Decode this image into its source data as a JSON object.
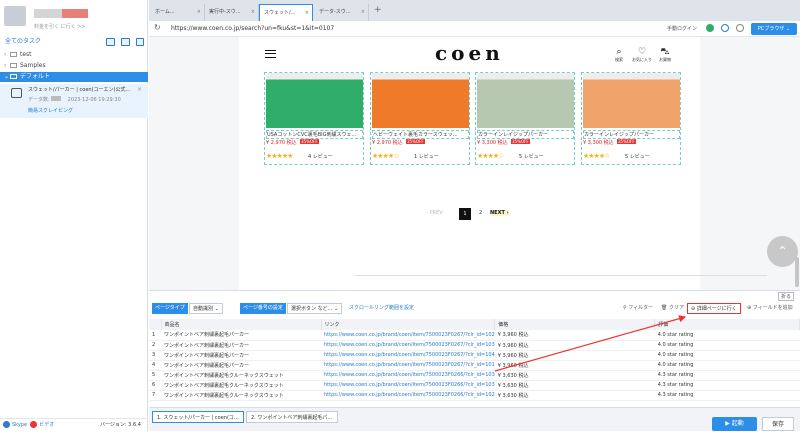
{
  "user": {
    "subtitle": "料金を引く に行く >>"
  },
  "sidebar": {
    "all_tasks": "全てのタスク",
    "folders": [
      {
        "name": "test"
      },
      {
        "name": "Samples"
      }
    ],
    "default_group": "デフォルト",
    "task": {
      "title": "スウェット/パーカー | coen(コーエン)公式...",
      "data_label": "データ数:",
      "date": "2023-12-06 19:29:30",
      "link": "簡易スクレイピング"
    },
    "footer": {
      "skype": "Skype",
      "video": "ビデオ",
      "version": "バージョン: 3.6.4"
    }
  },
  "browser": {
    "tabs": [
      {
        "label": "ホーム..."
      },
      {
        "label": "実行中-スウ..."
      },
      {
        "label": "スウェット/..."
      },
      {
        "label": "データ-スウ..."
      }
    ],
    "plus": "+",
    "url": "https://www.coen.co.jp/search?un=fku&st=1&it=0107",
    "login": "手動ログイン",
    "mode_button": "PCブラウザ ⌄"
  },
  "page": {
    "logo": "coen",
    "header_icons": [
      {
        "name": "search",
        "glyph": "⌕",
        "label": "検索"
      },
      {
        "name": "heart",
        "glyph": "♡",
        "label": "お気に入り"
      },
      {
        "name": "cart",
        "glyph": "⛍",
        "label": "お買物"
      }
    ],
    "products": [
      {
        "title": "USAコットンCVC裏毛BIG刺繍スウェ...",
        "price": "¥ 2,970 税込",
        "off": "35%OFF",
        "stars": "★★★★★",
        "reviews": "4 レビュー",
        "color": "#2fae6a"
      },
      {
        "title": "ヘビーウェイト裏毛カラースウェッ...",
        "price": "¥ 2,970 税込",
        "off": "35%OFF",
        "stars": "★★★★☆",
        "reviews": "1 レビュー",
        "color": "#ef7a2a"
      },
      {
        "title": "カラーインレイジップパーカー",
        "price": "¥ 3,300 税込",
        "off": "35%OFF",
        "stars": "★★★★☆",
        "reviews": "5 レビュー",
        "color": "#b7c8b0"
      },
      {
        "title": "カラーインレイジップパーカー",
        "price": "¥ 3,300 税込",
        "off": "35%OFF",
        "stars": "★★★★☆",
        "reviews": "5 レビュー",
        "color": "#f0a36a"
      }
    ],
    "pager": {
      "prev": "‹ PREV",
      "current": "1",
      "next_page": "2",
      "next": "NEXT ›"
    },
    "to_top": "⌃"
  },
  "panel": {
    "collapse": "折る",
    "page_type_tag": "ページタイプ",
    "page_type_value": "自動識別 ⌄",
    "page_num_tag": "ページ番号の設定",
    "page_num_value": "選択ボタン など... ⌄",
    "scroll_link": "スクロールリング範囲を設定",
    "filter": "フィルター",
    "clear": "クリア",
    "detail": "詳細ページに行く",
    "add_field": "フィールドを追加",
    "columns": [
      "",
      "商品名",
      "リンク",
      "価格",
      "評価"
    ],
    "rows": [
      [
        "1",
        "ワンポイントベア刺繍裏起毛パーカー",
        "https://www.coen.co.jp/brand/coen/item/7500023F0267/?clr_id=102",
        "¥ 3,960 税込",
        "4.0 star rating"
      ],
      [
        "2",
        "ワンポイントベア刺繍裏起毛パーカー",
        "https://www.coen.co.jp/brand/coen/item/7500023F0267/?clr_id=103",
        "¥ 3,960 税込",
        "4.0 star rating"
      ],
      [
        "3",
        "ワンポイントベア刺繍裏起毛パーカー",
        "https://www.coen.co.jp/brand/coen/item/7500023F0267/?clr_id=104",
        "¥ 3,960 税込",
        "4.0 star rating"
      ],
      [
        "4",
        "ワンポイントベア刺繍裏起毛パーカー",
        "https://www.coen.co.jp/brand/coen/item/7500023F0267/?clr_id=101",
        "¥ 3,960 税込",
        "4.0 star rating"
      ],
      [
        "5",
        "ワンポイントベア刺繍裏起毛クルーネックスウェット",
        "https://www.coen.co.jp/brand/coen/item/7500023F0266/?clr_id=103",
        "¥ 3,630 税込",
        "4.3 star rating"
      ],
      [
        "6",
        "ワンポイントベア刺繍裏起毛クルーネックスウェット",
        "https://www.coen.co.jp/brand/coen/item/7500023F0266/?clr_id=103",
        "¥ 3,630 税込",
        "4.3 star rating"
      ],
      [
        "7",
        "ワンポイントベア刺繍裏起毛クルーネックスウェット",
        "https://www.coen.co.jp/brand/coen/item/7500023F0266/?clr_id=102",
        "¥ 3,630 税込",
        "4.3 star rating"
      ]
    ]
  },
  "bottom_tabs": [
    {
      "label": "1. スウェット/パーカー | coen(コ..."
    },
    {
      "label": "2. ワンポイントベア刺繍裏起毛パ..."
    }
  ],
  "actions": {
    "run": "▶ 起動",
    "save": "保存"
  }
}
